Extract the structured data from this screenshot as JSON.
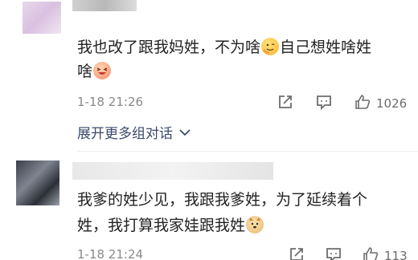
{
  "comments": [
    {
      "username": "一个小月",
      "text_line1_a": "我也改了跟我妈姓，不为啥",
      "text_line1_b": "自己想姓啥姓",
      "text_line2": "啥",
      "emoji1": "smirk-emoji",
      "emoji2": "laughing-emoji",
      "time": "1-18 21:26",
      "like_count": "1026"
    },
    {
      "text_line1": "我爹的姓少见，我跟我爹姓，为了延续着个",
      "text_line2": "姓，我打算我家娃跟我姓",
      "emoji1": "doge-emoji",
      "time": "1-18 21:24",
      "like_count": "113"
    }
  ],
  "expand_label": "展开更多组对话",
  "colors": {
    "link": "#3b4a6b",
    "meta": "#8a8a8a",
    "icon": "#6d6d6d"
  }
}
